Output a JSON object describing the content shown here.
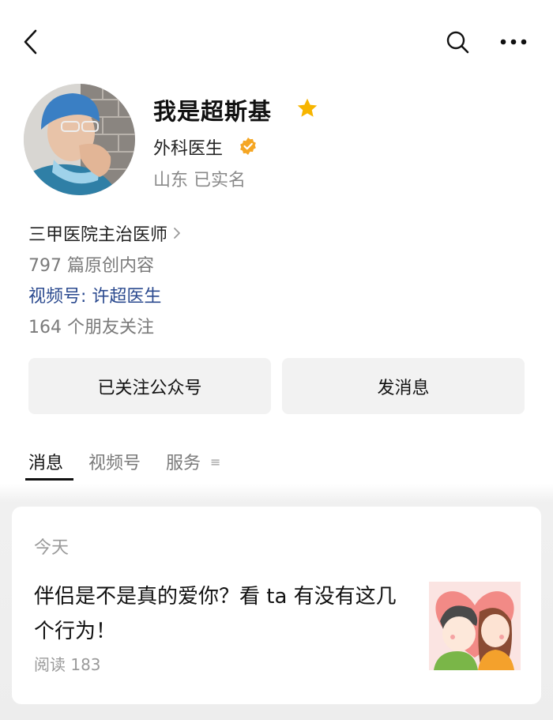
{
  "header": {
    "back_icon": "chevron-left-icon",
    "search_icon": "search-icon",
    "more_icon": "more-icon"
  },
  "profile": {
    "name": "我是超斯基",
    "star_icon": "star-icon",
    "star_color": "#f7b500",
    "category": "外科医生",
    "verified_color": "#f5a623",
    "location": "山东 已实名",
    "company": "三甲医院主治医师",
    "article_count": "797 篇原创内容",
    "video_channel": "视频号: 许超医生",
    "friends": "164 个朋友关注"
  },
  "actions": {
    "follow_label": "已关注公众号",
    "message_label": "发消息"
  },
  "tabs": [
    {
      "label": "消息",
      "active": true
    },
    {
      "label": "视频号",
      "active": false
    },
    {
      "label": "服务",
      "active": false
    }
  ],
  "feed": {
    "date": "今天",
    "article_title": "伴侣是不是真的爱你？看 ta 有没有这几个行为！",
    "reads": "阅读 183"
  },
  "colors": {
    "link": "#2b4a8f",
    "muted": "#7a7a7a",
    "button_bg": "#f2f2f2"
  }
}
